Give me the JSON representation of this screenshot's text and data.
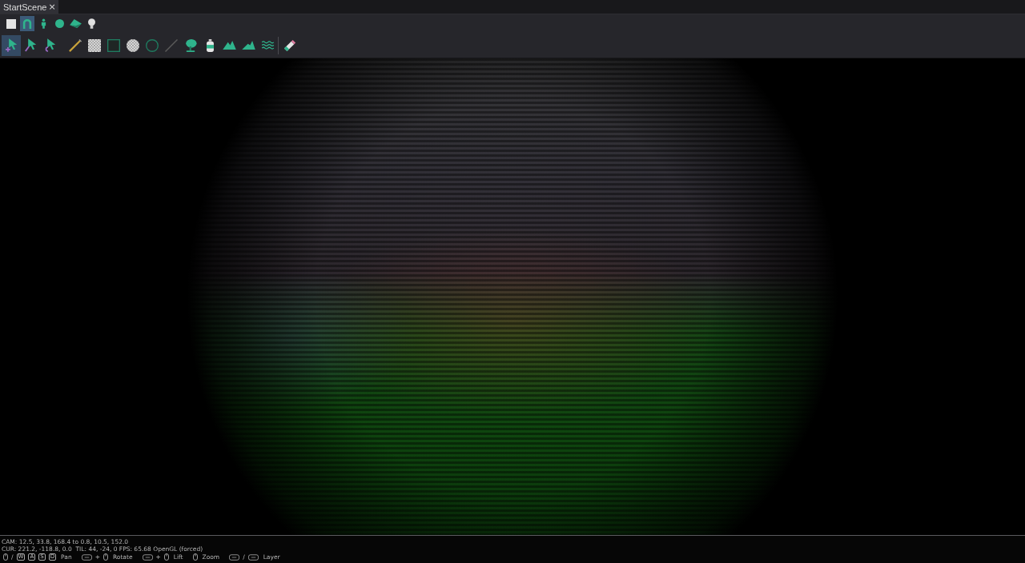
{
  "tabs": [
    {
      "label": "StartScene",
      "close": "×",
      "selected": true
    }
  ],
  "object_toolbar": [
    {
      "kind": "cube",
      "selected": false
    },
    {
      "kind": "arch",
      "selected": true
    },
    {
      "kind": "person",
      "selected": false
    },
    {
      "kind": "sphere",
      "selected": false
    },
    {
      "kind": "plane",
      "selected": false
    },
    {
      "kind": "bulb",
      "selected": false
    }
  ],
  "tool_groups": [
    {
      "separator": false,
      "tools": [
        {
          "kind": "select-plus",
          "selected": true
        },
        {
          "kind": "select-pen",
          "selected": false
        },
        {
          "kind": "select-curve",
          "selected": false
        }
      ]
    },
    {
      "separator": false,
      "tools": [
        {
          "kind": "pencil",
          "selected": false
        },
        {
          "kind": "checker-square",
          "selected": false
        },
        {
          "kind": "square",
          "selected": false
        },
        {
          "kind": "checker-circle",
          "selected": false
        },
        {
          "kind": "circle",
          "selected": false
        },
        {
          "kind": "line",
          "selected": false
        },
        {
          "kind": "tree",
          "selected": false
        },
        {
          "kind": "spray",
          "selected": false
        },
        {
          "kind": "mountain",
          "selected": false
        },
        {
          "kind": "mountain-small",
          "selected": false
        },
        {
          "kind": "waves",
          "selected": false
        }
      ]
    },
    {
      "separator": true,
      "tools": [
        {
          "kind": "eraser",
          "selected": false
        }
      ]
    }
  ],
  "status": {
    "lines": [
      "CAM: 12.5, 33.8, 168.4 to 0.8, 10.5, 152.0",
      "CUR: 221.2, -118.8, 0.0  TIL: 44, -24, 0 FPS: 65.68 OpenGL (forced)"
    ],
    "controls": [
      {
        "kind": "mouse"
      },
      {
        "kind": "text",
        "text": "/"
      },
      {
        "kind": "key",
        "text": "W"
      },
      {
        "kind": "key",
        "text": "A"
      },
      {
        "kind": "key",
        "text": "S"
      },
      {
        "kind": "key",
        "text": "D"
      },
      {
        "kind": "label",
        "text": "Pan"
      },
      {
        "kind": "key"
      },
      {
        "kind": "text",
        "text": "+"
      },
      {
        "kind": "mouse"
      },
      {
        "kind": "label",
        "text": "Rotate"
      },
      {
        "kind": "key"
      },
      {
        "kind": "text",
        "text": "+"
      },
      {
        "kind": "mouse"
      },
      {
        "kind": "label",
        "text": "Lift"
      },
      {
        "kind": "mouse"
      },
      {
        "kind": "label",
        "text": "Zoom"
      },
      {
        "kind": "key"
      },
      {
        "kind": "text",
        "text": "/"
      },
      {
        "kind": "key"
      },
      {
        "kind": "label",
        "text": "Layer"
      }
    ]
  }
}
